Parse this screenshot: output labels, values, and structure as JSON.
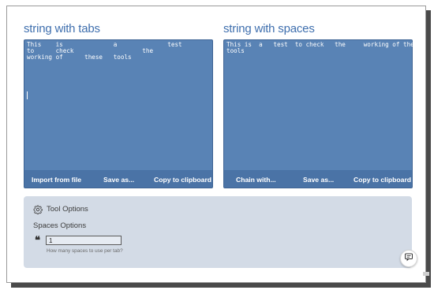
{
  "left_panel": {
    "title": "string with tabs",
    "text": "This    is              a              test\nto      check                   the\nworking of      these   tools",
    "buttons": {
      "import": "Import from file",
      "save": "Save as...",
      "copy": "Copy to clipboard"
    }
  },
  "right_panel": {
    "title": "string with spaces",
    "text": "This is  a   test  to check   the     working of these\ntools",
    "buttons": {
      "chain": "Chain with...",
      "save": "Save as...",
      "copy": "Copy to clipboard"
    }
  },
  "tool_options": {
    "title": "Tool Options",
    "section_label": "Spaces Options",
    "spaces_input_value": "1",
    "spaces_help": "How many spaces to use per tab?"
  },
  "icons": {
    "settings": "gear-icon",
    "quote": "quote-icon",
    "chat": "chat-icon"
  },
  "colors": {
    "panel_bg": "#5983b5",
    "action_bar": "#4a73a6",
    "title": "#3f6fae",
    "options_bg": "#d3dbe6"
  }
}
